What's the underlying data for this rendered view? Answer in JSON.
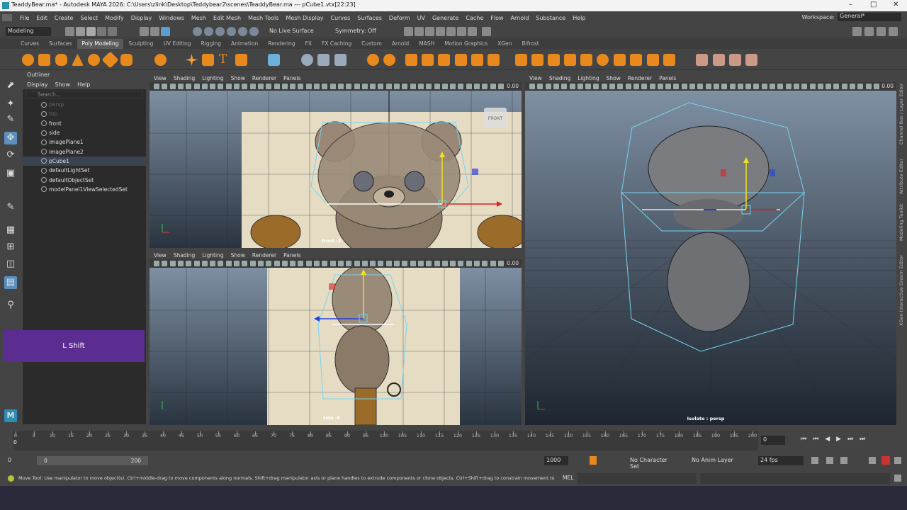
{
  "window": {
    "title": "TeaddyBear.ma* - Autodesk MAYA 2026: C:\\Users\\zlink\\Desktop\\Teddybear2\\scenes\\TeaddyBear.ma   ---   pCube1.vtx[22:23]"
  },
  "menubar": [
    "File",
    "Edit",
    "Create",
    "Select",
    "Modify",
    "Display",
    "Windows",
    "Mesh",
    "Edit Mesh",
    "Mesh Tools",
    "Mesh Display",
    "Curves",
    "Surfaces",
    "Deform",
    "UV",
    "Generate",
    "Cache",
    "Flow",
    "Arnold",
    "Substance",
    "Help"
  ],
  "workspace": {
    "label": "Workspace:",
    "value": "General*"
  },
  "statusline": {
    "mode": "Modeling",
    "live_surface": "No Live Surface",
    "symmetry": "Symmetry: Off"
  },
  "shelf_tabs": [
    "Curves",
    "Surfaces",
    "Poly Modeling",
    "Sculpting",
    "UV Editing",
    "Rigging",
    "Animation",
    "Rendering",
    "FX",
    "FX Caching",
    "Custom",
    "Arnold",
    "MASH",
    "Motion Graphics",
    "XGen",
    "Bifrost"
  ],
  "shelf_active": "Poly Modeling",
  "outliner": {
    "title": "Outliner",
    "menu": [
      "Display",
      "Show",
      "Help"
    ],
    "search_placeholder": "Search...",
    "items": [
      {
        "label": "persp",
        "dim": true
      },
      {
        "label": "top",
        "dim": true
      },
      {
        "label": "front",
        "dim": false
      },
      {
        "label": "side",
        "dim": false
      },
      {
        "label": "imagePlane1",
        "dim": false
      },
      {
        "label": "imagePlane2",
        "dim": false
      },
      {
        "label": "pCube1",
        "dim": false,
        "selected": true
      },
      {
        "label": "defaultLightSet",
        "dim": false
      },
      {
        "label": "defaultObjectSet",
        "dim": false
      },
      {
        "label": "modelPanel1ViewSelectedSet",
        "dim": false
      }
    ]
  },
  "key_overlay": "L Shift",
  "viewports": {
    "menu": [
      "View",
      "Shading",
      "Lighting",
      "Show",
      "Renderer",
      "Panels"
    ],
    "num": "0.00",
    "front": {
      "label": "front -Z",
      "cube": "FRONT"
    },
    "side": {
      "label": "side -X"
    },
    "persp": {
      "label": "Isolate : persp"
    }
  },
  "side_tabs": [
    "Channel Box / Layer Editor",
    "Attribute Editor",
    "Modeling Toolkit",
    "XGen Interactive Groom Editor"
  ],
  "timeline": {
    "ticks": [
      "0",
      "5",
      "10",
      "15",
      "20",
      "25",
      "30",
      "35",
      "40",
      "45",
      "50",
      "55",
      "60",
      "65",
      "70",
      "75",
      "80",
      "85",
      "90",
      "95",
      "100",
      "105",
      "110",
      "115",
      "120",
      "125",
      "130",
      "135",
      "140",
      "145",
      "150",
      "155",
      "160",
      "165",
      "170",
      "175",
      "180",
      "185",
      "190",
      "195",
      "200"
    ],
    "current": "0",
    "frame_field": "0"
  },
  "range": {
    "start": "0",
    "inner_start": "0",
    "inner_end": "200",
    "end": "1000",
    "character_set": "No Character Set",
    "anim_layer": "No Anim Layer",
    "fps": "24 fps"
  },
  "helpline": {
    "text": "Move Tool: Use manipulator to move object(s). Ctrl+middle-drag to move components along normals. Shift+drag manipulator axis or plane handles to extrude components or clone objects. Ctrl+Shift+drag to constrain movement to a connected edge. Use D",
    "mel": "MEL"
  },
  "colors": {
    "maya_blue": "#4aa3df",
    "selection_cyan": "#76d4f0",
    "overlay_purple": "#5c2d91",
    "x_axis": "#e02020",
    "y_axis": "#f0e020",
    "z_axis": "#2040e0"
  }
}
